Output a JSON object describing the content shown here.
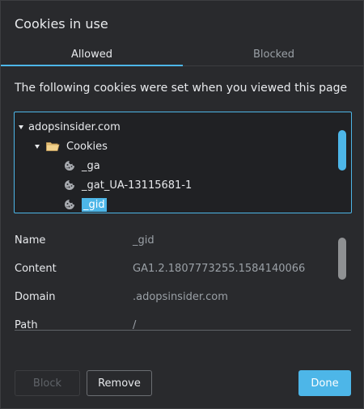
{
  "dialog": {
    "title": "Cookies in use",
    "tabs": [
      {
        "label": "Allowed",
        "selected": true
      },
      {
        "label": "Blocked",
        "selected": false
      }
    ],
    "description": "The following cookies were set when you viewed this page"
  },
  "tree": {
    "site": "adopsinsider.com",
    "folder": "Cookies",
    "cookies": [
      "_ga",
      "_gat_UA-13115681-1",
      "_gid"
    ],
    "selected": "_gid"
  },
  "details": {
    "rows": [
      {
        "label": "Name",
        "value": "_gid"
      },
      {
        "label": "Content",
        "value": "GA1.2.1807773255.1584140066"
      },
      {
        "label": "Domain",
        "value": ".adopsinsider.com"
      },
      {
        "label": "Path",
        "value": "/"
      }
    ]
  },
  "buttons": {
    "block": "Block",
    "remove": "Remove",
    "done": "Done"
  },
  "colors": {
    "accent": "#4db6e8",
    "background": "#292a2d"
  }
}
